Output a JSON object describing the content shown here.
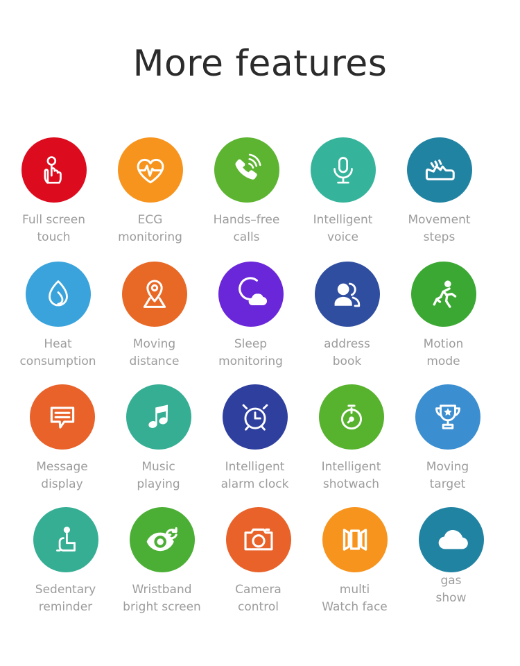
{
  "header": {
    "title": "More features"
  },
  "theme": {
    "background": "#ffffff",
    "title_color": "#2b2b2b",
    "label_color": "#9c9c9c",
    "icon_color": "#ffffff"
  },
  "grid": {
    "columns": 5,
    "rows": 4
  },
  "features": [
    {
      "label": "Full screen\ntouch",
      "icon": "touch-hand-icon",
      "color": "#dd0b1e"
    },
    {
      "label": "ECG\nmonitoring",
      "icon": "heart-pulse-icon",
      "color": "#f7941e"
    },
    {
      "label": "Hands–free\ncalls",
      "icon": "phone-signal-icon",
      "color": "#5cb431"
    },
    {
      "label": "Intelligent\nvoice",
      "icon": "microphone-icon",
      "color": "#35b49b"
    },
    {
      "label": "Movement\nsteps",
      "icon": "sneaker-icon",
      "color": "#2183a2"
    },
    {
      "label": "Heat\nconsumption",
      "icon": "flame-icon",
      "color": "#3aa3dc"
    },
    {
      "label": "Moving\ndistance",
      "icon": "map-pin-icon",
      "color": "#e86826"
    },
    {
      "label": "Sleep\nmonitoring",
      "icon": "moon-cloud-icon",
      "color": "#6a26d9"
    },
    {
      "label": "address\nbook",
      "icon": "contacts-people-icon",
      "color": "#2f4ea0"
    },
    {
      "label": "Motion\nmode",
      "icon": "running-person-icon",
      "color": "#3aa832"
    },
    {
      "label": "Message\ndisplay",
      "icon": "message-bubble-icon",
      "color": "#e8622a"
    },
    {
      "label": "Music\nplaying",
      "icon": "music-note-icon",
      "color": "#35ae94"
    },
    {
      "label": "Intelligent\nalarm clock",
      "icon": "alarm-clock-icon",
      "color": "#2f3f9e"
    },
    {
      "label": "Intelligent\nshotwach",
      "icon": "stopwatch-icon",
      "color": "#57b22e"
    },
    {
      "label": "Moving\ntarget",
      "icon": "trophy-icon",
      "color": "#3b8ed0"
    },
    {
      "label": "Sedentary\nreminder",
      "icon": "seated-person-icon",
      "color": "#35ae94"
    },
    {
      "label": "Wristband\nbright screen",
      "icon": "eye-refresh-icon",
      "color": "#4caf35"
    },
    {
      "label": "Camera\ncontrol",
      "icon": "camera-icon",
      "color": "#e8622a"
    },
    {
      "label": "multi\nWatch face",
      "icon": "carousel-panels-icon",
      "color": "#f7941e"
    },
    {
      "label": "gas\nshow",
      "icon": "cloud-icon",
      "color": "#2183a2"
    }
  ]
}
